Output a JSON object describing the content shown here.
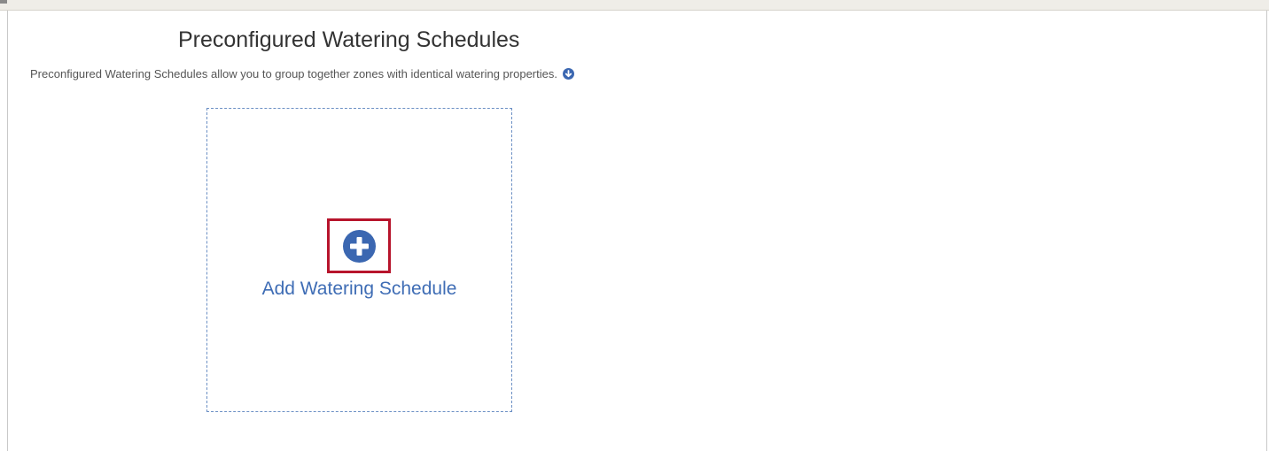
{
  "header": {
    "title": "Preconfigured Watering Schedules",
    "description": "Preconfigured Watering Schedules allow you to group together zones with identical watering properties."
  },
  "add_card": {
    "label": "Add Watering Schedule",
    "icon": "plus-circle-icon"
  },
  "icons": {
    "expand_description": "chevron-down-circle-icon"
  },
  "colors": {
    "accent": "#3f6db5",
    "icon_fill": "#3b67b1",
    "highlight_border": "#b7142c",
    "card_border": "#6b8fc4",
    "title_text": "#333333",
    "description_text": "#555555"
  }
}
